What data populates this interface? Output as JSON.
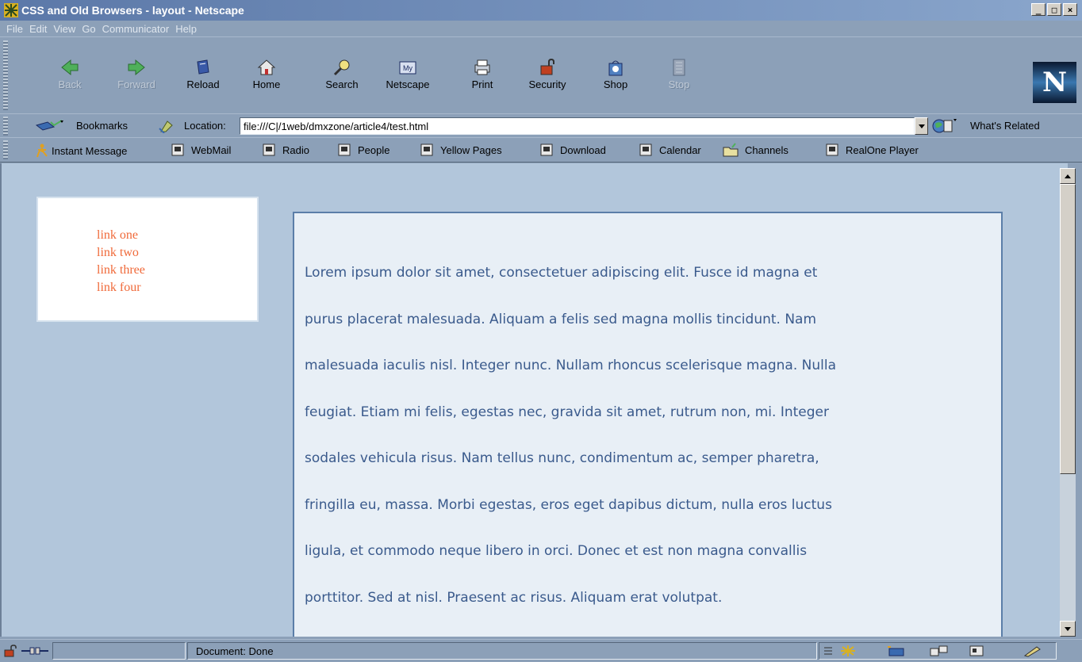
{
  "window": {
    "title": "CSS and Old Browsers - layout - Netscape",
    "min_label": "_",
    "max_label": "□",
    "close_label": "×"
  },
  "menu": [
    "File",
    "Edit",
    "View",
    "Go",
    "Communicator",
    "Help"
  ],
  "navbar": {
    "buttons": [
      {
        "label": "Back",
        "icon": "back-arrow-icon",
        "enabled": false
      },
      {
        "label": "Forward",
        "icon": "forward-arrow-icon",
        "enabled": false
      },
      {
        "label": "Reload",
        "icon": "reload-icon",
        "enabled": true
      },
      {
        "label": "Home",
        "icon": "home-icon",
        "enabled": true
      },
      {
        "label": "Search",
        "icon": "search-icon",
        "enabled": true
      },
      {
        "label": "Netscape",
        "icon": "my-netscape-icon",
        "enabled": true
      },
      {
        "label": "Print",
        "icon": "print-icon",
        "enabled": true
      },
      {
        "label": "Security",
        "icon": "security-lock-icon",
        "enabled": true
      },
      {
        "label": "Shop",
        "icon": "shop-bag-icon",
        "enabled": true
      },
      {
        "label": "Stop",
        "icon": "stop-icon",
        "enabled": false
      }
    ],
    "logo_letter": "N",
    "my_netscape_badge": "My"
  },
  "locbar": {
    "bookmarks_label": "Bookmarks",
    "location_label": "Location:",
    "url": "file:///C|/1web/dmxzone/article4/test.html",
    "whats_related_label": "What's Related"
  },
  "personal_toolbar": [
    "Instant Message",
    "WebMail",
    "Radio",
    "People",
    "Yellow Pages",
    "Download",
    "Calendar",
    "Channels",
    "RealOne Player"
  ],
  "page": {
    "links": [
      "link one",
      "link two",
      "link three",
      "link four"
    ],
    "lines": [
      "Lorem ipsum dolor sit amet, consectetuer adipiscing elit. Fusce id magna et",
      "purus placerat malesuada. Aliquam a felis sed magna mollis tincidunt. Nam",
      "malesuada iaculis nisl. Integer nunc. Nullam rhoncus scelerisque magna. Nulla",
      "feugiat. Etiam mi felis, egestas nec, gravida sit amet, rutrum non, mi. Integer",
      "sodales vehicula risus. Nam tellus nunc, condimentum ac, semper pharetra,",
      "fringilla eu, massa. Morbi egestas, eros eget dapibus dictum, nulla eros luctus",
      "ligula, et commodo neque libero in orci. Donec et est non magna convallis",
      "porttitor. Sed at nisl. Praesent ac risus. Aliquam erat volutpat."
    ],
    "link_color": "#f06a3a",
    "text_color": "#3a5a8c",
    "page_bg": "#b2c6db",
    "box_bg": "#e8eff6"
  },
  "status": {
    "text": "Document: Done"
  }
}
